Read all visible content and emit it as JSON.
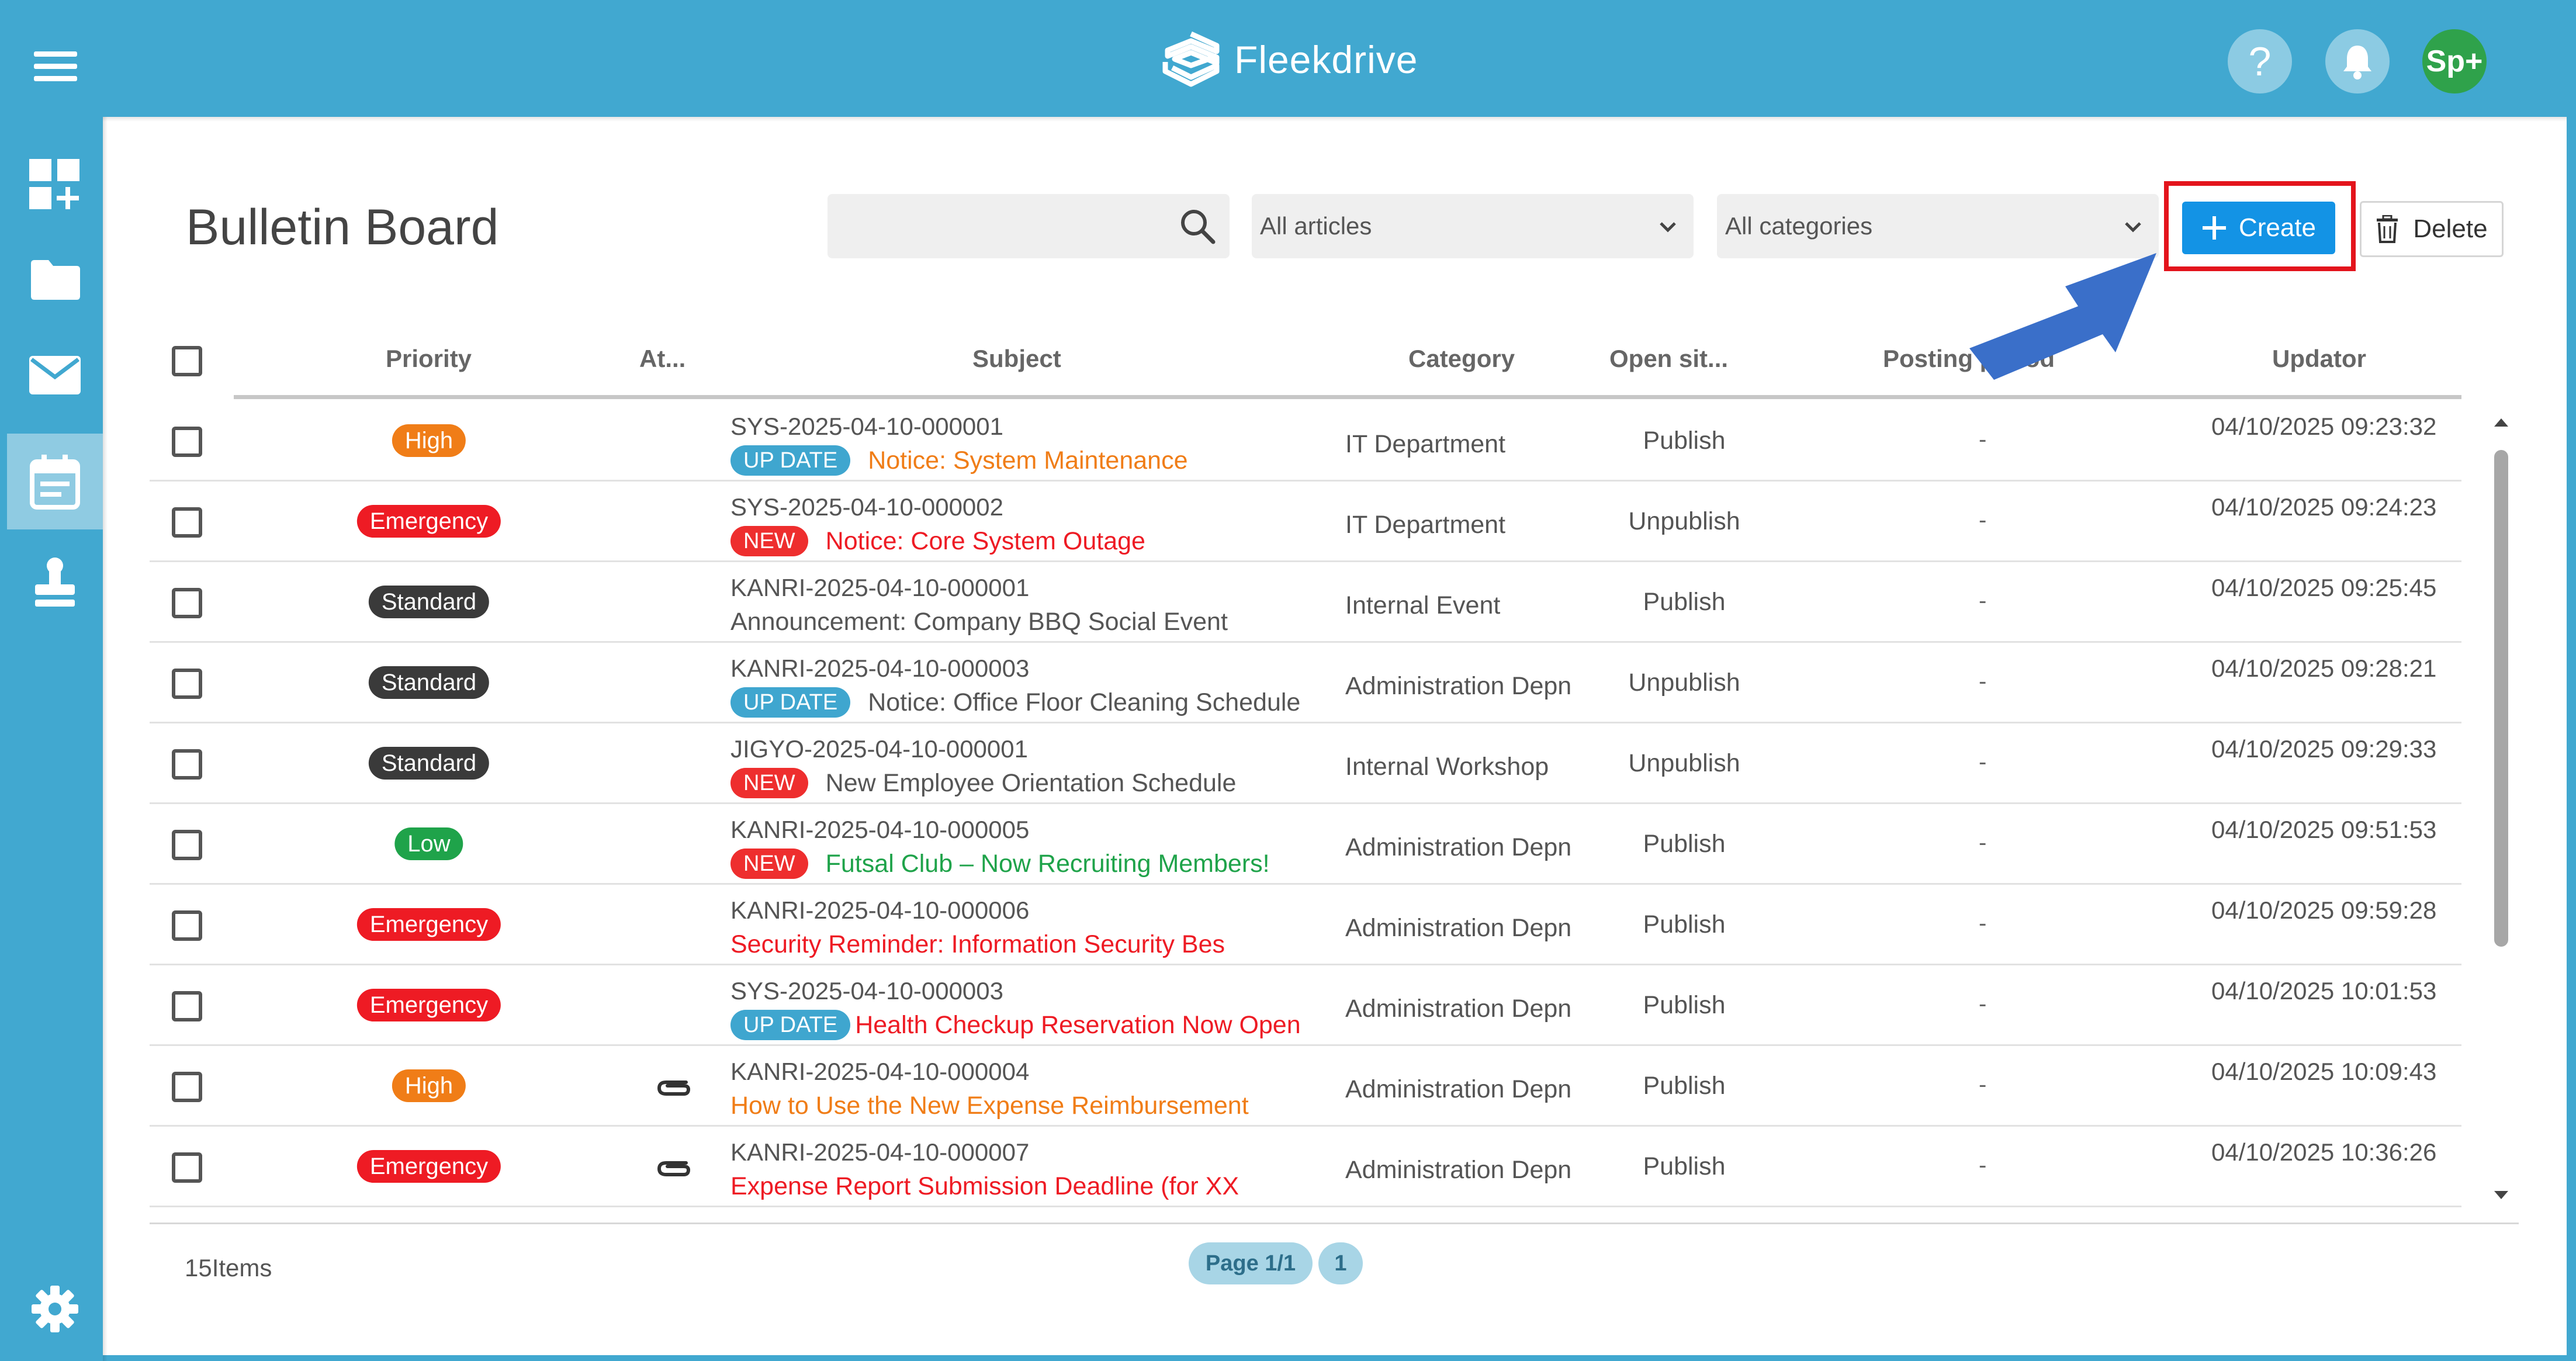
{
  "app": {
    "name": "Fleekdrive",
    "user_initials": "Sp+"
  },
  "header": {
    "help_glyph": "?"
  },
  "page": {
    "title": "Bulletin Board"
  },
  "toolbar": {
    "search_value": "",
    "articles_filter": "All articles",
    "categories_filter": "All categories",
    "create_label": "Create",
    "delete_label": "Delete"
  },
  "table": {
    "headers": {
      "priority": "Priority",
      "attachment": "At...",
      "subject": "Subject",
      "category": "Category",
      "open_status": "Open sit...",
      "posting_period": "Posting period",
      "updator": "Updator"
    },
    "rows": [
      {
        "priority": "High",
        "priority_color": "#f07d17",
        "attachment": false,
        "id": "SYS-2025-04-10-000001",
        "tag": "UP DATE",
        "tag_color": "#3fa6cf",
        "subject": "Notice: System Maintenance",
        "subject_color": "#f07d17",
        "category": "IT Department",
        "open_status": "Publish",
        "posting": "-",
        "updated": "04/10/2025 09:23:32"
      },
      {
        "priority": "Emergency",
        "priority_color": "#ee1b24",
        "attachment": false,
        "id": "SYS-2025-04-10-000002",
        "tag": "NEW",
        "tag_color": "#ee2e2e",
        "subject": "Notice: Core System Outage",
        "subject_color": "#ee1b24",
        "category": "IT Department",
        "open_status": "Unpublish",
        "posting": "-",
        "updated": "04/10/2025 09:24:23"
      },
      {
        "priority": "Standard",
        "priority_color": "#3a3a3a",
        "attachment": false,
        "id": "KANRI-2025-04-10-000001",
        "tag": "",
        "tag_color": "",
        "subject": "Announcement: Company BBQ Social Event",
        "subject_color": "#555555",
        "category": "Internal Event",
        "open_status": "Publish",
        "posting": "-",
        "updated": "04/10/2025 09:25:45"
      },
      {
        "priority": "Standard",
        "priority_color": "#3a3a3a",
        "attachment": false,
        "id": "KANRI-2025-04-10-000003",
        "tag": "UP DATE",
        "tag_color": "#3fa6cf",
        "subject": "Notice: Office Floor Cleaning Schedule",
        "subject_color": "#555555",
        "category": "Administration Depn",
        "open_status": "Unpublish",
        "posting": "-",
        "updated": "04/10/2025 09:28:21"
      },
      {
        "priority": "Standard",
        "priority_color": "#3a3a3a",
        "attachment": false,
        "id": "JIGYO-2025-04-10-000001",
        "tag": "NEW",
        "tag_color": "#ee2e2e",
        "subject": "New Employee Orientation Schedule",
        "subject_color": "#555555",
        "category": "Internal Workshop",
        "open_status": "Unpublish",
        "posting": "-",
        "updated": "04/10/2025 09:29:33"
      },
      {
        "priority": "Low",
        "priority_color": "#1fa34a",
        "attachment": false,
        "id": "KANRI-2025-04-10-000005",
        "tag": "NEW",
        "tag_color": "#ee2e2e",
        "subject": "Futsal Club – Now Recruiting Members!",
        "subject_color": "#1fa34a",
        "category": "Administration Depn",
        "open_status": "Publish",
        "posting": "-",
        "updated": "04/10/2025 09:51:53"
      },
      {
        "priority": "Emergency",
        "priority_color": "#ee1b24",
        "attachment": false,
        "id": "KANRI-2025-04-10-000006",
        "tag": "",
        "tag_color": "",
        "subject": "Security Reminder: Information Security Bes",
        "subject_color": "#ee1b24",
        "category": "Administration Depn",
        "open_status": "Publish",
        "posting": "-",
        "updated": "04/10/2025 09:59:28"
      },
      {
        "priority": "Emergency",
        "priority_color": "#ee1b24",
        "attachment": false,
        "id": "SYS-2025-04-10-000003",
        "tag": "UP DATE",
        "tag_color": "#3fa6cf",
        "subject": "Health Checkup Reservation Now Open",
        "subject_color": "#ee1b24",
        "category": "Administration Depn",
        "open_status": "Publish",
        "posting": "-",
        "updated": "04/10/2025 10:01:53"
      },
      {
        "priority": "High",
        "priority_color": "#f07d17",
        "attachment": true,
        "id": "KANRI-2025-04-10-000004",
        "tag": "",
        "tag_color": "",
        "subject": "How to Use the New Expense Reimbursement",
        "subject_color": "#f07d17",
        "category": "Administration Depn",
        "open_status": "Publish",
        "posting": "-",
        "updated": "04/10/2025 10:09:43"
      },
      {
        "priority": "Emergency",
        "priority_color": "#ee1b24",
        "attachment": true,
        "id": "KANRI-2025-04-10-000007",
        "tag": "",
        "tag_color": "",
        "subject": "Expense Report Submission Deadline (for XX",
        "subject_color": "#ee1b24",
        "category": "Administration Depn",
        "open_status": "Publish",
        "posting": "-",
        "updated": "04/10/2025 10:36:26"
      }
    ]
  },
  "footer": {
    "items_count": "15Items",
    "page_label": "Page 1/1",
    "current_page": "1"
  },
  "colors": {
    "brand": "#41a8d0",
    "create_button": "#1393e5",
    "highlight_box": "#e3141c",
    "annotation_arrow": "#3a6fc9"
  },
  "icons": [
    "menu-icon",
    "fleekdrive-logo-icon",
    "help-icon",
    "bell-icon",
    "dashboard-add-icon",
    "folder-icon",
    "mail-icon",
    "calendar-board-icon",
    "stamp-icon",
    "gear-icon",
    "search-icon",
    "chevron-down-icon",
    "plus-icon",
    "trash-icon",
    "paperclip-icon"
  ]
}
